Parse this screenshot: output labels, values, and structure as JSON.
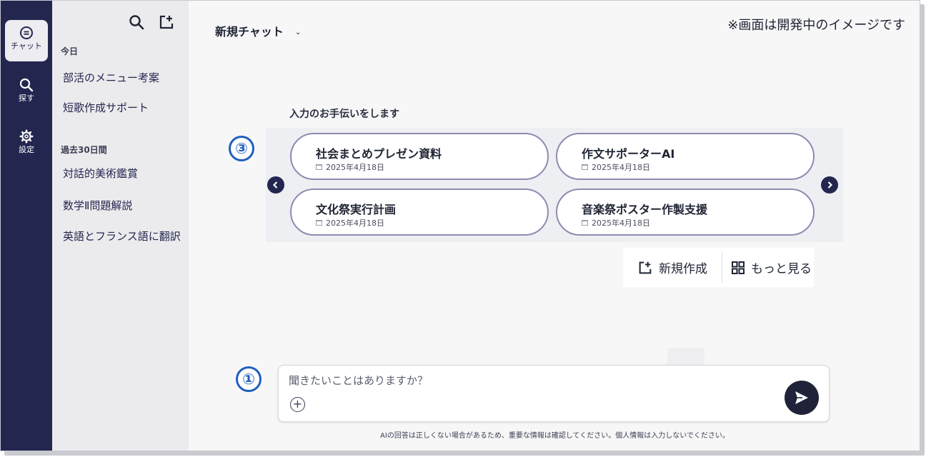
{
  "rail": {
    "items": [
      {
        "label": "チャット",
        "icon": "chat-bubble-icon",
        "active": true
      },
      {
        "label": "探す",
        "icon": "search-icon",
        "active": false
      },
      {
        "label": "設定",
        "icon": "gear-icon",
        "active": false
      }
    ]
  },
  "sidebar": {
    "icons": [
      "search-icon",
      "new-chat-icon"
    ],
    "sections": [
      {
        "label": "今日",
        "items": [
          "部活のメニュー考案",
          "短歌作成サポート"
        ]
      },
      {
        "label": "過去30日間",
        "items": [
          "対話的美術鑑賞",
          "数学Ⅱ問題解説",
          "英語とフランス語に翻訳"
        ]
      }
    ]
  },
  "header": {
    "title": "新規チャット",
    "notice": "※画面は開発中のイメージです"
  },
  "assist": {
    "heading": "入力のお手伝いをします",
    "cards": [
      {
        "title": "社会まとめプレゼン資料",
        "date": "2025年4月18日"
      },
      {
        "title": "作文サポーターAI",
        "date": "2025年4月18日"
      },
      {
        "title": "文化祭実行計画",
        "date": "2025年4月18日"
      },
      {
        "title": "音楽祭ポスター作製支援",
        "date": "2025年4月18日"
      }
    ],
    "actions": {
      "new": "新規作成",
      "more": "もっと見る"
    }
  },
  "markers": {
    "carousel": "③",
    "input": "①"
  },
  "composer": {
    "placeholder": "聞きたいことはありますか？",
    "plus": "+"
  },
  "footer": {
    "disclaimer": "AIの回答は正しくない場合があるため、重要な情報は確認してください。個人情報は入力しないでください。"
  },
  "colors": {
    "rail": "#23264f",
    "card_border": "#8f8ab2",
    "marker": "#1f5fbf"
  }
}
